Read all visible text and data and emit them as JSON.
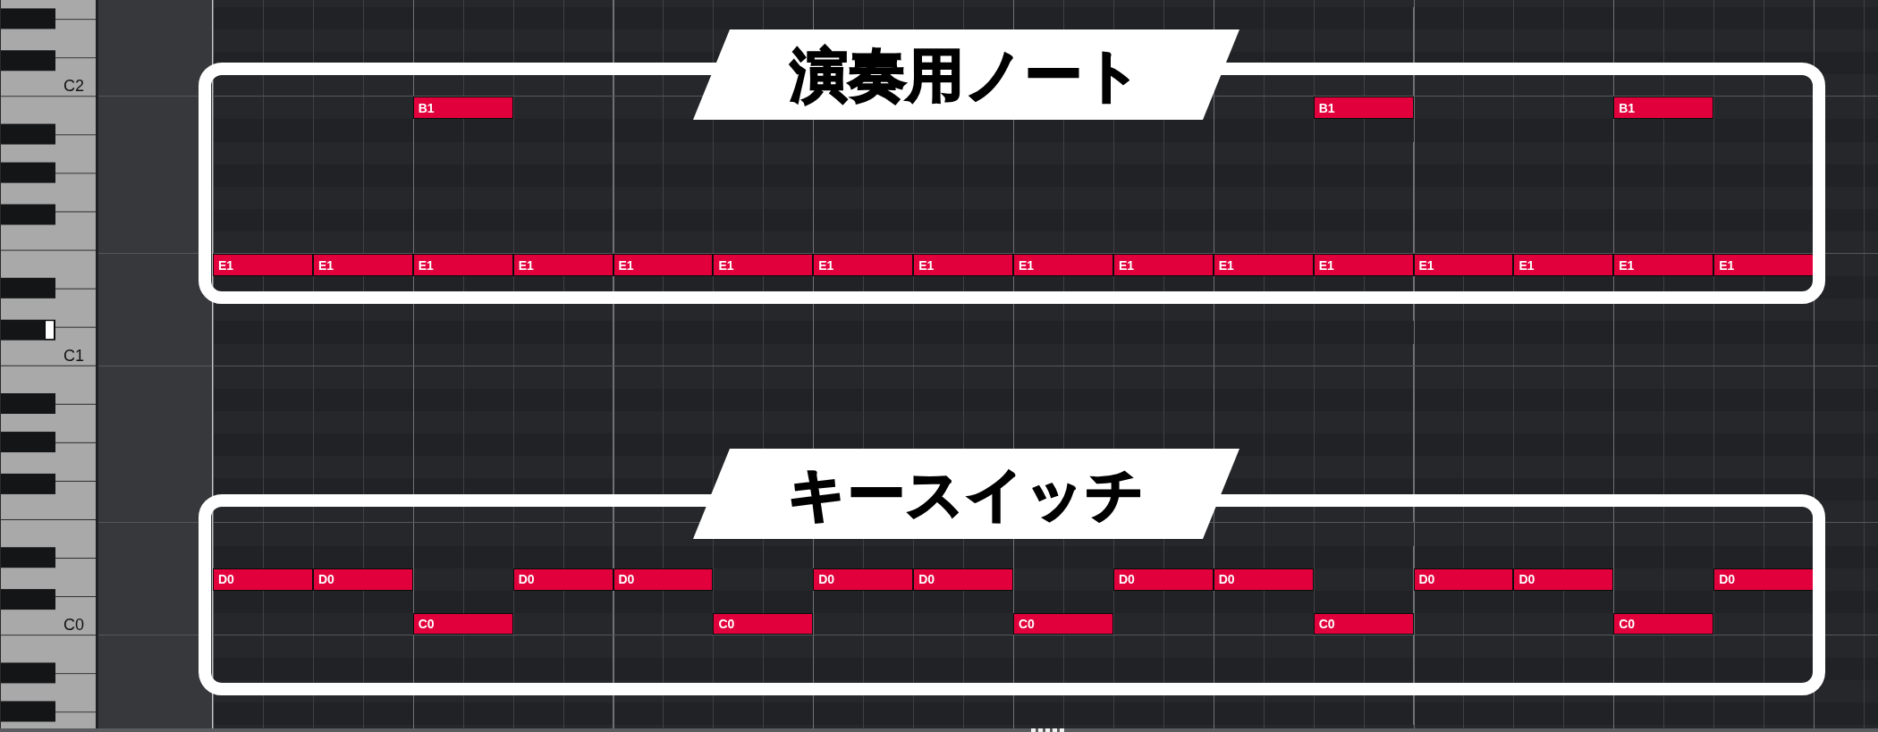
{
  "keyboard": {
    "keys": [
      {
        "kind": "natural"
      },
      {
        "kind": "sharp",
        "marked": false
      },
      {
        "kind": "natural"
      },
      {
        "kind": "sharp",
        "marked": false
      },
      {
        "kind": "natural",
        "label": "C2"
      },
      {
        "kind": "natural"
      },
      {
        "kind": "sharp",
        "marked": false
      },
      {
        "kind": "natural"
      },
      {
        "kind": "sharp",
        "marked": false
      },
      {
        "kind": "natural"
      },
      {
        "kind": "sharp",
        "marked": false
      },
      {
        "kind": "natural"
      },
      {
        "kind": "natural"
      },
      {
        "kind": "sharp",
        "marked": false
      },
      {
        "kind": "natural"
      },
      {
        "kind": "sharp",
        "marked": true
      },
      {
        "kind": "natural",
        "label": "C1"
      },
      {
        "kind": "natural"
      },
      {
        "kind": "sharp",
        "marked": false
      },
      {
        "kind": "natural"
      },
      {
        "kind": "sharp",
        "marked": false
      },
      {
        "kind": "natural"
      },
      {
        "kind": "sharp",
        "marked": false
      },
      {
        "kind": "natural"
      },
      {
        "kind": "natural"
      },
      {
        "kind": "sharp",
        "marked": false
      },
      {
        "kind": "natural"
      },
      {
        "kind": "sharp",
        "marked": false
      },
      {
        "kind": "natural",
        "label": "C0"
      },
      {
        "kind": "natural"
      },
      {
        "kind": "sharp",
        "marked": false
      },
      {
        "kind": "natural"
      },
      {
        "kind": "sharp",
        "marked": false
      },
      {
        "kind": "natural"
      }
    ]
  },
  "piano_roll": {
    "rows": [
      {
        "kind": "natural"
      },
      {
        "kind": "sharp"
      },
      {
        "kind": "natural"
      },
      {
        "kind": "sharp"
      },
      {
        "kind": "natural"
      },
      {
        "kind": "natural",
        "steps": [
          {
            "kind": "rest"
          },
          {
            "kind": "rest"
          },
          {
            "kind": "note",
            "label": "B1"
          },
          {
            "kind": "rest"
          },
          {
            "kind": "rest"
          },
          {
            "kind": "rest"
          },
          {
            "kind": "rest"
          },
          {
            "kind": "rest"
          },
          {
            "kind": "rest"
          },
          {
            "kind": "rest"
          },
          {
            "kind": "rest"
          },
          {
            "kind": "note",
            "label": "B1"
          },
          {
            "kind": "rest"
          },
          {
            "kind": "rest"
          },
          {
            "kind": "note",
            "label": "B1"
          },
          {
            "kind": "rest"
          }
        ]
      },
      {
        "kind": "sharp"
      },
      {
        "kind": "natural"
      },
      {
        "kind": "sharp"
      },
      {
        "kind": "natural"
      },
      {
        "kind": "sharp"
      },
      {
        "kind": "natural"
      },
      {
        "kind": "natural",
        "steps": [
          {
            "kind": "note",
            "label": "E1"
          },
          {
            "kind": "note",
            "label": "E1"
          },
          {
            "kind": "note",
            "label": "E1"
          },
          {
            "kind": "note",
            "label": "E1"
          },
          {
            "kind": "note",
            "label": "E1"
          },
          {
            "kind": "note",
            "label": "E1"
          },
          {
            "kind": "note",
            "label": "E1"
          },
          {
            "kind": "note",
            "label": "E1"
          },
          {
            "kind": "note",
            "label": "E1"
          },
          {
            "kind": "note",
            "label": "E1"
          },
          {
            "kind": "note",
            "label": "E1"
          },
          {
            "kind": "note",
            "label": "E1"
          },
          {
            "kind": "note",
            "label": "E1"
          },
          {
            "kind": "note",
            "label": "E1"
          },
          {
            "kind": "note",
            "label": "E1"
          },
          {
            "kind": "note",
            "label": "E1"
          }
        ]
      },
      {
        "kind": "sharp"
      },
      {
        "kind": "natural"
      },
      {
        "kind": "sharp"
      },
      {
        "kind": "natural"
      },
      {
        "kind": "natural"
      },
      {
        "kind": "sharp"
      },
      {
        "kind": "natural"
      },
      {
        "kind": "sharp"
      },
      {
        "kind": "natural"
      },
      {
        "kind": "sharp"
      },
      {
        "kind": "natural"
      },
      {
        "kind": "natural"
      },
      {
        "kind": "sharp"
      },
      {
        "kind": "natural",
        "steps": [
          {
            "kind": "note",
            "label": "D0"
          },
          {
            "kind": "note",
            "label": "D0"
          },
          {
            "kind": "rest"
          },
          {
            "kind": "note",
            "label": "D0"
          },
          {
            "kind": "note",
            "label": "D0"
          },
          {
            "kind": "rest"
          },
          {
            "kind": "note",
            "label": "D0"
          },
          {
            "kind": "note",
            "label": "D0"
          },
          {
            "kind": "rest"
          },
          {
            "kind": "note",
            "label": "D0"
          },
          {
            "kind": "note",
            "label": "D0"
          },
          {
            "kind": "rest"
          },
          {
            "kind": "note",
            "label": "D0"
          },
          {
            "kind": "note",
            "label": "D0"
          },
          {
            "kind": "rest"
          },
          {
            "kind": "note",
            "label": "D0"
          }
        ]
      },
      {
        "kind": "sharp"
      },
      {
        "kind": "natural",
        "steps": [
          {
            "kind": "rest"
          },
          {
            "kind": "rest"
          },
          {
            "kind": "note",
            "label": "C0"
          },
          {
            "kind": "rest"
          },
          {
            "kind": "rest"
          },
          {
            "kind": "note",
            "label": "C0"
          },
          {
            "kind": "rest"
          },
          {
            "kind": "rest"
          },
          {
            "kind": "note",
            "label": "C0"
          },
          {
            "kind": "rest"
          },
          {
            "kind": "rest"
          },
          {
            "kind": "note",
            "label": "C0"
          },
          {
            "kind": "rest"
          },
          {
            "kind": "rest"
          },
          {
            "kind": "note",
            "label": "C0"
          },
          {
            "kind": "rest"
          }
        ]
      },
      {
        "kind": "natural"
      },
      {
        "kind": "sharp"
      },
      {
        "kind": "natural"
      },
      {
        "kind": "sharp"
      },
      {
        "kind": "natural"
      }
    ]
  },
  "callouts": [
    {
      "title": "演奏用ノート"
    },
    {
      "title": "キースイッチ"
    }
  ]
}
